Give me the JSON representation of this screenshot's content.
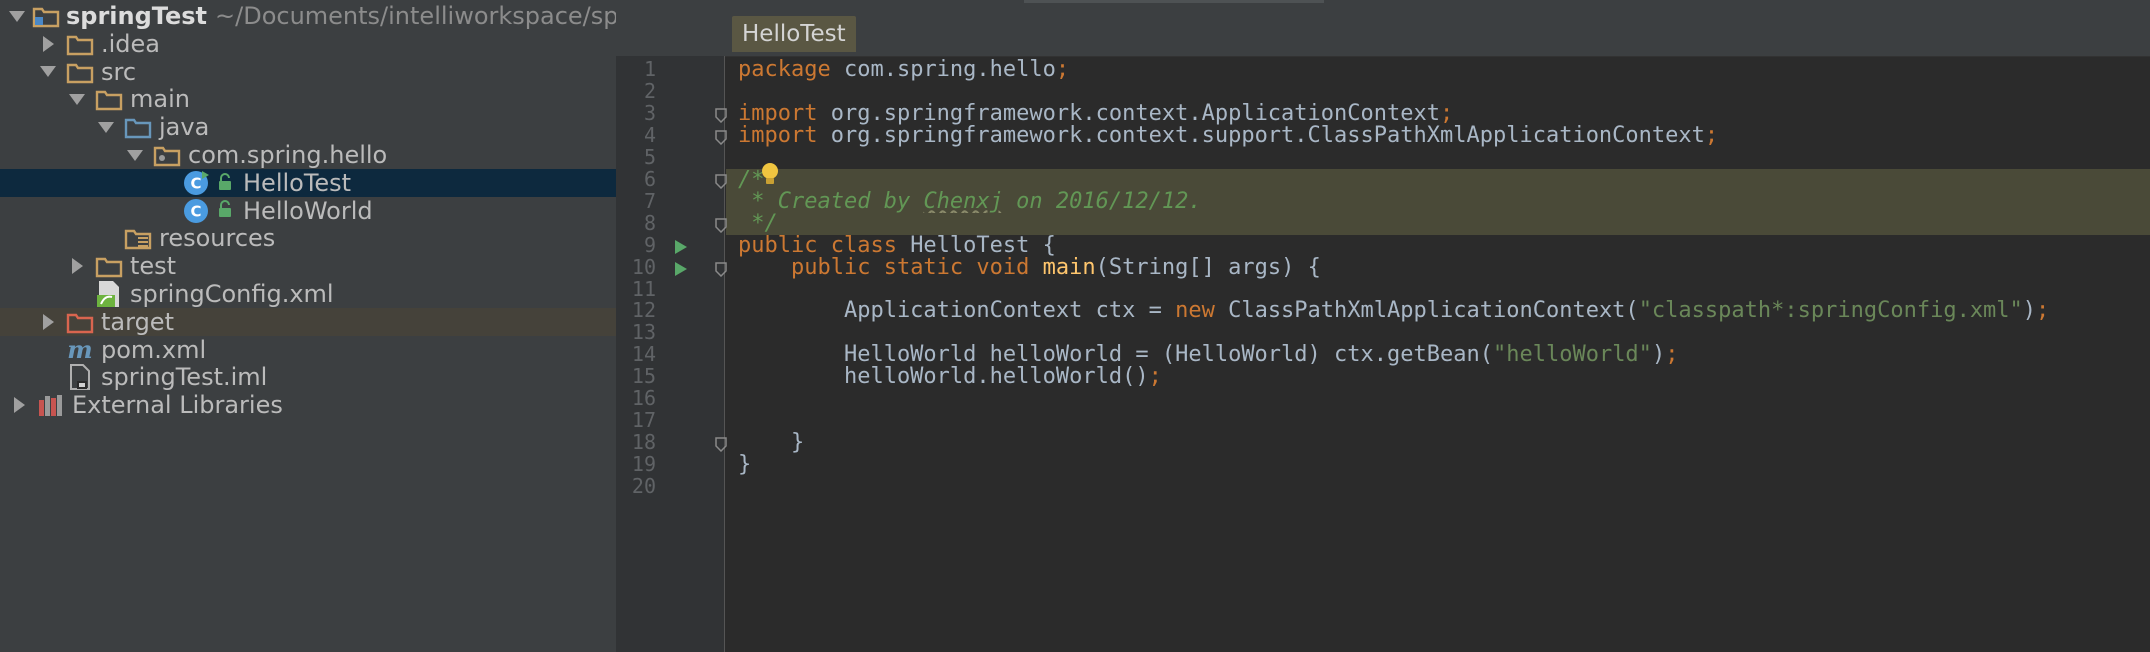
{
  "project_tree": {
    "rows": [
      {
        "label": "springTest",
        "path": "~/Documents/intelliworkspace/sp",
        "indent": 0,
        "arrow": "down",
        "icon": "folder-module",
        "bold": true
      },
      {
        "label": ".idea",
        "indent": 1,
        "arrow": "right",
        "icon": "folder"
      },
      {
        "label": "src",
        "indent": 1,
        "arrow": "down",
        "icon": "folder"
      },
      {
        "label": "main",
        "indent": 2,
        "arrow": "down",
        "icon": "folder"
      },
      {
        "label": "java",
        "indent": 3,
        "arrow": "down",
        "icon": "folder-source"
      },
      {
        "label": "com.spring.hello",
        "indent": 4,
        "arrow": "down",
        "icon": "package"
      },
      {
        "label": "HelloTest",
        "indent": 5,
        "arrow": "none",
        "icon": "class-runnable",
        "selected": true
      },
      {
        "label": "HelloWorld",
        "indent": 5,
        "arrow": "none",
        "icon": "class"
      },
      {
        "label": "resources",
        "indent": 3,
        "arrow": "none",
        "icon": "folder-resources"
      },
      {
        "label": "test",
        "indent": 2,
        "arrow": "right",
        "icon": "folder"
      },
      {
        "label": "springConfig.xml",
        "indent": 2,
        "arrow": "none",
        "icon": "xml-spring"
      },
      {
        "label": "target",
        "indent": 1,
        "arrow": "right",
        "icon": "folder-excluded",
        "excluded": true
      },
      {
        "label": "pom.xml",
        "indent": 1,
        "arrow": "none",
        "icon": "maven"
      },
      {
        "label": "springTest.iml",
        "indent": 1,
        "arrow": "none",
        "icon": "iml-file"
      },
      {
        "label": "External Libraries",
        "indent": 0,
        "arrow": "right",
        "icon": "libraries"
      }
    ]
  },
  "editor": {
    "tab_label": "HelloTest",
    "lines": [
      {
        "n": "1",
        "parts": [
          [
            "kw",
            "package "
          ],
          [
            "plain",
            "com.spring.hello"
          ],
          [
            "kw",
            ";"
          ]
        ]
      },
      {
        "n": "2",
        "parts": []
      },
      {
        "n": "3",
        "fold": true,
        "parts": [
          [
            "kw",
            "import "
          ],
          [
            "plain",
            "org.springframework.context.ApplicationContext"
          ],
          [
            "kw",
            ";"
          ]
        ]
      },
      {
        "n": "4",
        "fold": true,
        "parts": [
          [
            "kw",
            "import "
          ],
          [
            "plain",
            "org.springframework.context.support.ClassPathXmlApplicationContext"
          ],
          [
            "kw",
            ";"
          ]
        ]
      },
      {
        "n": "5",
        "parts": []
      },
      {
        "n": "6",
        "fold": true,
        "hl": true,
        "bulb": true,
        "parts": [
          [
            "cmt",
            "/*"
          ]
        ]
      },
      {
        "n": "7",
        "hl": true,
        "parts": [
          [
            "cmt",
            " * Created by "
          ],
          [
            "cmt-squig",
            "Chenxj"
          ],
          [
            "cmt",
            " on 2016/12/12."
          ]
        ]
      },
      {
        "n": "8",
        "fold": true,
        "hl": true,
        "parts": [
          [
            "cmt",
            " */"
          ]
        ]
      },
      {
        "n": "9",
        "run": true,
        "parts": [
          [
            "kw",
            "public class "
          ],
          [
            "plain",
            "HelloTest {"
          ]
        ]
      },
      {
        "n": "10",
        "run": true,
        "fold": true,
        "parts": [
          [
            "plain",
            "    "
          ],
          [
            "kw",
            "public static void "
          ],
          [
            "fn",
            "main"
          ],
          [
            "plain",
            "(String[] args) {"
          ]
        ]
      },
      {
        "n": "11",
        "parts": []
      },
      {
        "n": "12",
        "parts": [
          [
            "plain",
            "        ApplicationContext ctx = "
          ],
          [
            "kw",
            "new "
          ],
          [
            "plain",
            "ClassPathXmlApplicationContext("
          ],
          [
            "str",
            "\"classpath*:springConfig.xml\""
          ],
          [
            "plain",
            ")"
          ],
          [
            "kw",
            ";"
          ]
        ]
      },
      {
        "n": "13",
        "parts": []
      },
      {
        "n": "14",
        "parts": [
          [
            "plain",
            "        HelloWorld helloWorld = (HelloWorld) ctx.getBean("
          ],
          [
            "str",
            "\"helloWorld\""
          ],
          [
            "plain",
            ")"
          ],
          [
            "kw",
            ";"
          ]
        ]
      },
      {
        "n": "15",
        "parts": [
          [
            "plain",
            "        helloWorld.helloWorld()"
          ],
          [
            "kw",
            ";"
          ]
        ]
      },
      {
        "n": "16",
        "parts": []
      },
      {
        "n": "17",
        "parts": []
      },
      {
        "n": "18",
        "fold": true,
        "parts": [
          [
            "plain",
            "    }"
          ]
        ]
      },
      {
        "n": "19",
        "parts": [
          [
            "plain",
            "}"
          ]
        ]
      },
      {
        "n": "20",
        "parts": []
      }
    ]
  },
  "colors": {
    "keyword": "#cc7832",
    "string": "#6a8759",
    "comment": "#629755",
    "method": "#ffc66d",
    "plain": "#a9b7c6",
    "selection": "#0d293e"
  }
}
